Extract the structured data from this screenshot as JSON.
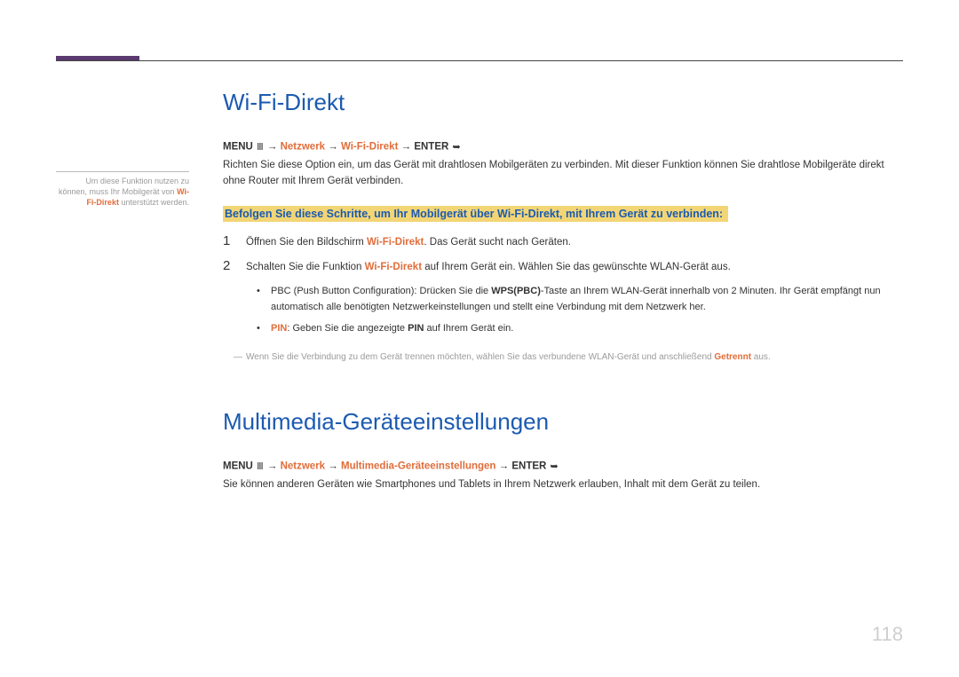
{
  "sidebar": {
    "pre": "Um diese Funktion nutzen zu können, muss Ihr Mobilgerät von ",
    "hl": "Wi-Fi-Direkt",
    "post": " unterstützt werden."
  },
  "s1": {
    "title": "Wi-Fi-Direkt",
    "bc": {
      "menu": "MENU",
      "arrow": "→",
      "net": "Netzwerk",
      "item": "Wi-Fi-Direkt",
      "enter": "ENTER"
    },
    "desc": "Richten Sie diese Option ein, um das Gerät mit drahtlosen Mobilgeräten zu verbinden. Mit dieser Funktion können Sie drahtlose Mobilgeräte direkt ohne Router mit Ihrem Gerät verbinden.",
    "highlight": "Befolgen Sie diese Schritte, um Ihr Mobilgerät über Wi-Fi-Direkt, mit Ihrem Gerät zu verbinden:",
    "step1": {
      "num": "1",
      "pre": "Öffnen Sie den Bildschirm ",
      "hl": "Wi-Fi-Direkt",
      "post": ". Das Gerät sucht nach Geräten."
    },
    "step2": {
      "num": "2",
      "pre": "Schalten Sie die Funktion ",
      "hl": "Wi-Fi-Direkt",
      "post": " auf Ihrem Gerät ein. Wählen Sie das gewünschte WLAN-Gerät aus.",
      "b1": {
        "pre": "PBC (Push Button Configuration): Drücken Sie die ",
        "strong": "WPS(PBC)",
        "post": "-Taste an Ihrem WLAN-Gerät innerhalb von 2 Minuten. Ihr Gerät empfängt nun automatisch alle benötigten Netzwerkeinstellungen und stellt eine Verbindung mit dem Netzwerk her."
      },
      "b2": {
        "hl": "PIN",
        "mid": ": Geben Sie die angezeigte ",
        "strong": "PIN",
        "post": " auf Ihrem Gerät ein."
      }
    },
    "note": {
      "pre": "Wenn Sie die Verbindung zu dem Gerät trennen möchten, wählen Sie das verbundene WLAN-Gerät und anschließend ",
      "hl": "Getrennt",
      "post": " aus."
    }
  },
  "s2": {
    "title": "Multimedia-Geräteeinstellungen",
    "bc": {
      "menu": "MENU",
      "arrow": "→",
      "net": "Netzwerk",
      "item": "Multimedia-Geräteeinstellungen",
      "enter": "ENTER"
    },
    "desc": "Sie können anderen Geräten wie Smartphones und Tablets in Ihrem Netzwerk erlauben, Inhalt mit dem Gerät zu teilen."
  },
  "pagenum": "118",
  "icons": {
    "menu": "Ⅲ",
    "enter": "➥"
  }
}
